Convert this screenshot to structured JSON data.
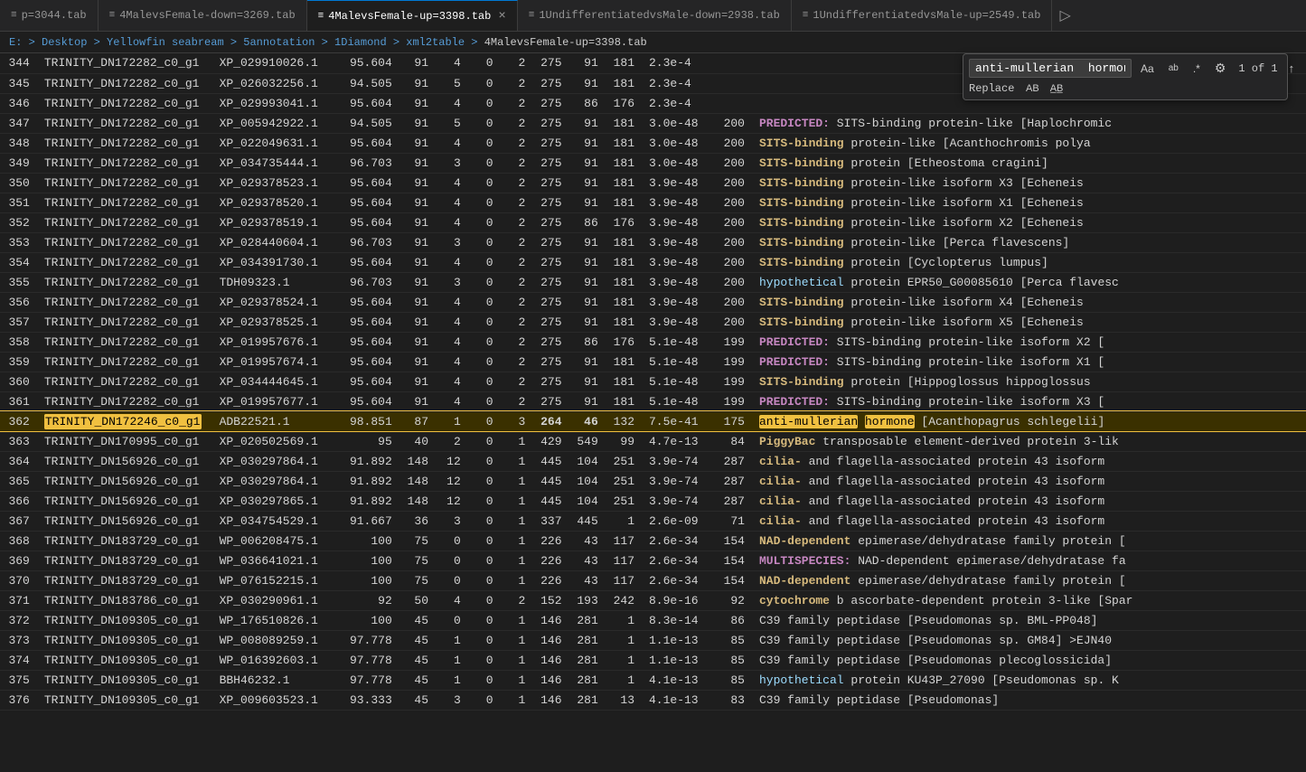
{
  "tabs": [
    {
      "id": "tab1",
      "icon": "≡",
      "label": "p=3044.tab",
      "active": false,
      "closable": false
    },
    {
      "id": "tab2",
      "icon": "≡",
      "label": "4MalevsFemale-down=3269.tab",
      "active": false,
      "closable": false
    },
    {
      "id": "tab3",
      "icon": "≡",
      "label": "4MalevsFemale-up=3398.tab",
      "active": true,
      "closable": true
    },
    {
      "id": "tab4",
      "icon": "≡",
      "label": "1UndifferentiatedvsMale-down=2938.tab",
      "active": false,
      "closable": false
    },
    {
      "id": "tab5",
      "icon": "≡",
      "label": "1UndifferentiatedvsMale-up=2549.tab",
      "active": false,
      "closable": false
    }
  ],
  "breadcrumb": {
    "parts": [
      "E:",
      "Desktop",
      "Yellowfin seabream",
      "5annotation",
      "1Diamond",
      "xml2table",
      "4MalevsFemale-up=3398.tab"
    ]
  },
  "find_widget": {
    "search_value": "anti-mullerian  hormone",
    "count_label": "1 of 1",
    "replace_label": "Replace",
    "buttons": {
      "match_case": "Aa",
      "whole_word": "ab",
      "regex": ".*",
      "settings": "⚙",
      "prev": "↑",
      "next": "↓",
      "expand": "☰",
      "close": "×",
      "replace_one": "AB",
      "replace_all": "AB̄"
    }
  },
  "table": {
    "rows": [
      {
        "line": 344,
        "trinity": "TRINITY_DN172282_c0_g1",
        "xp": "XP_029910026.1",
        "num1": "95.604",
        "num2": 91,
        "num3": 4,
        "num4": 0,
        "num5": 2,
        "num6": 275,
        "num7": 91,
        "num8": 181,
        "evalue": "2.3e-4",
        "score": "",
        "desc": "",
        "desc2": ""
      },
      {
        "line": 345,
        "trinity": "TRINITY_DN172282_c0_g1",
        "xp": "XP_026032256.1",
        "num1": "94.505",
        "num2": 91,
        "num3": 5,
        "num4": 0,
        "num5": 2,
        "num6": 275,
        "num7": 91,
        "num8": 181,
        "evalue": "2.3e-4",
        "score": "",
        "desc": "",
        "desc2": ""
      },
      {
        "line": 346,
        "trinity": "TRINITY_DN172282_c0_g1",
        "xp": "XP_029993041.1",
        "num1": "95.604",
        "num2": 91,
        "num3": 4,
        "num4": 0,
        "num5": 2,
        "num6": 275,
        "num7": 86,
        "num8": 176,
        "evalue": "2.3e-4",
        "score": "",
        "desc": "",
        "desc2": ""
      },
      {
        "line": 347,
        "trinity": "TRINITY_DN172282_c0_g1",
        "xp": "XP_005942922.1",
        "num1": "94.505",
        "num2": 91,
        "num3": 5,
        "num4": 0,
        "num5": 2,
        "num6": 275,
        "num7": 91,
        "num8": 181,
        "evalue": "3.0e-48",
        "score": 200,
        "desc": "PREDICTED:",
        "desc2": "SITS-binding protein-like [Haplochromic"
      },
      {
        "line": 348,
        "trinity": "TRINITY_DN172282_c0_g1",
        "xp": "XP_022049631.1",
        "num1": "95.604",
        "num2": 91,
        "num3": 4,
        "num4": 0,
        "num5": 2,
        "num6": 275,
        "num7": 91,
        "num8": 181,
        "evalue": "3.0e-48",
        "score": 200,
        "desc": "SITS-binding",
        "desc2": "protein-like [Acanthochromis polya"
      },
      {
        "line": 349,
        "trinity": "TRINITY_DN172282_c0_g1",
        "xp": "XP_034735444.1",
        "num1": "96.703",
        "num2": 91,
        "num3": 3,
        "num4": 0,
        "num5": 2,
        "num6": 275,
        "num7": 91,
        "num8": 181,
        "evalue": "3.0e-48",
        "score": 200,
        "desc": "SITS-binding",
        "desc2": "protein [Etheostoma cragini]"
      },
      {
        "line": 350,
        "trinity": "TRINITY_DN172282_c0_g1",
        "xp": "XP_029378523.1",
        "num1": "95.604",
        "num2": 91,
        "num3": 4,
        "num4": 0,
        "num5": 2,
        "num6": 275,
        "num7": 91,
        "num8": 181,
        "evalue": "3.9e-48",
        "score": 200,
        "desc": "SITS-binding",
        "desc2": "protein-like isoform X3 [Echeneis"
      },
      {
        "line": 351,
        "trinity": "TRINITY_DN172282_c0_g1",
        "xp": "XP_029378520.1",
        "num1": "95.604",
        "num2": 91,
        "num3": 4,
        "num4": 0,
        "num5": 2,
        "num6": 275,
        "num7": 91,
        "num8": 181,
        "evalue": "3.9e-48",
        "score": 200,
        "desc": "SITS-binding",
        "desc2": "protein-like isoform X1 [Echeneis"
      },
      {
        "line": 352,
        "trinity": "TRINITY_DN172282_c0_g1",
        "xp": "XP_029378519.1",
        "num1": "95.604",
        "num2": 91,
        "num3": 4,
        "num4": 0,
        "num5": 2,
        "num6": 275,
        "num7": 86,
        "num8": 176,
        "evalue": "3.9e-48",
        "score": 200,
        "desc": "SITS-binding",
        "desc2": "protein-like isoform X2 [Echeneis"
      },
      {
        "line": 353,
        "trinity": "TRINITY_DN172282_c0_g1",
        "xp": "XP_028440604.1",
        "num1": "96.703",
        "num2": 91,
        "num3": 3,
        "num4": 0,
        "num5": 2,
        "num6": 275,
        "num7": 91,
        "num8": 181,
        "evalue": "3.9e-48",
        "score": 200,
        "desc": "SITS-binding",
        "desc2": "protein-like [Perca flavescens]"
      },
      {
        "line": 354,
        "trinity": "TRINITY_DN172282_c0_g1",
        "xp": "XP_034391730.1",
        "num1": "95.604",
        "num2": 91,
        "num3": 4,
        "num4": 0,
        "num5": 2,
        "num6": 275,
        "num7": 91,
        "num8": 181,
        "evalue": "3.9e-48",
        "score": 200,
        "desc": "SITS-binding",
        "desc2": "protein [Cyclopterus lumpus]"
      },
      {
        "line": 355,
        "trinity": "TRINITY_DN172282_c0_g1",
        "xp": "TDH09323.1",
        "num1": "96.703",
        "num2": 91,
        "num3": 3,
        "num4": 0,
        "num5": 2,
        "num6": 275,
        "num7": 91,
        "num8": 181,
        "evalue": "3.9e-48",
        "score": 200,
        "desc": "hypothetical",
        "desc2": "protein EPR50_G00085610 [Perca flavesc"
      },
      {
        "line": 356,
        "trinity": "TRINITY_DN172282_c0_g1",
        "xp": "XP_029378524.1",
        "num1": "95.604",
        "num2": 91,
        "num3": 4,
        "num4": 0,
        "num5": 2,
        "num6": 275,
        "num7": 91,
        "num8": 181,
        "evalue": "3.9e-48",
        "score": 200,
        "desc": "SITS-binding",
        "desc2": "protein-like isoform X4 [Echeneis"
      },
      {
        "line": 357,
        "trinity": "TRINITY_DN172282_c0_g1",
        "xp": "XP_029378525.1",
        "num1": "95.604",
        "num2": 91,
        "num3": 4,
        "num4": 0,
        "num5": 2,
        "num6": 275,
        "num7": 91,
        "num8": 181,
        "evalue": "3.9e-48",
        "score": 200,
        "desc": "SITS-binding",
        "desc2": "protein-like isoform X5 [Echeneis"
      },
      {
        "line": 358,
        "trinity": "TRINITY_DN172282_c0_g1",
        "xp": "XP_019957676.1",
        "num1": "95.604",
        "num2": 91,
        "num3": 4,
        "num4": 0,
        "num5": 2,
        "num6": 275,
        "num7": 86,
        "num8": 176,
        "evalue": "5.1e-48",
        "score": 199,
        "desc": "PREDICTED:",
        "desc2": "SITS-binding protein-like isoform X2 ["
      },
      {
        "line": 359,
        "trinity": "TRINITY_DN172282_c0_g1",
        "xp": "XP_019957674.1",
        "num1": "95.604",
        "num2": 91,
        "num3": 4,
        "num4": 0,
        "num5": 2,
        "num6": 275,
        "num7": 91,
        "num8": 181,
        "evalue": "5.1e-48",
        "score": 199,
        "desc": "PREDICTED:",
        "desc2": "SITS-binding protein-like isoform X1 ["
      },
      {
        "line": 360,
        "trinity": "TRINITY_DN172282_c0_g1",
        "xp": "XP_034444645.1",
        "num1": "95.604",
        "num2": 91,
        "num3": 4,
        "num4": 0,
        "num5": 2,
        "num6": 275,
        "num7": 91,
        "num8": 181,
        "evalue": "5.1e-48",
        "score": 199,
        "desc": "SITS-binding",
        "desc2": "protein [Hippoglossus hippoglossus"
      },
      {
        "line": 361,
        "trinity": "TRINITY_DN172282_c0_g1",
        "xp": "XP_019957677.1",
        "num1": "95.604",
        "num2": 91,
        "num3": 4,
        "num4": 0,
        "num5": 2,
        "num6": 275,
        "num7": 91,
        "num8": 181,
        "evalue": "5.1e-48",
        "score": 199,
        "desc": "PREDICTED:",
        "desc2": "SITS-binding protein-like isoform X3 ["
      },
      {
        "line": 362,
        "trinity": "TRINITY_DN172246_c0_g1",
        "xp": "ADB22521.1",
        "num1": "98.851",
        "num2": 87,
        "num3": 1,
        "num4": 0,
        "num5": 3,
        "num6": 264,
        "num7": 46,
        "num8": 132,
        "evalue": "7.5e-41",
        "score": 175,
        "desc": "anti-mullerian",
        "desc2": "hormone [Acanthopagrus schlegelii]",
        "highlighted": true
      },
      {
        "line": 363,
        "trinity": "TRINITY_DN170995_c0_g1",
        "xp": "XP_020502569.1",
        "num1": "95",
        "num2": 40,
        "num3": 2,
        "num4": 0,
        "num5": 1,
        "num6": 429,
        "num7": 549,
        "num8": 99,
        "evalue": "4.7e-13",
        "score": 84,
        "desc": "PiggyBac",
        "desc2": "transposable element-derived protein 3-lik"
      },
      {
        "line": 364,
        "trinity": "TRINITY_DN156926_c0_g1",
        "xp": "XP_030297864.1",
        "num1": "91.892",
        "num2": 148,
        "num3": 12,
        "num4": 0,
        "num5": 1,
        "num6": 445,
        "num7": 104,
        "num8": 251,
        "evalue": "3.9e-74",
        "score": 287,
        "desc": "cilia-",
        "desc2": "and flagella-associated protein 43 isoform"
      },
      {
        "line": 365,
        "trinity": "TRINITY_DN156926_c0_g1",
        "xp": "XP_030297864.1",
        "num1": "91.892",
        "num2": 148,
        "num3": 12,
        "num4": 0,
        "num5": 1,
        "num6": 445,
        "num7": 104,
        "num8": 251,
        "evalue": "3.9e-74",
        "score": 287,
        "desc": "cilia-",
        "desc2": "and flagella-associated protein 43 isoform"
      },
      {
        "line": 366,
        "trinity": "TRINITY_DN156926_c0_g1",
        "xp": "XP_030297865.1",
        "num1": "91.892",
        "num2": 148,
        "num3": 12,
        "num4": 0,
        "num5": 1,
        "num6": 445,
        "num7": 104,
        "num8": 251,
        "evalue": "3.9e-74",
        "score": 287,
        "desc": "cilia-",
        "desc2": "and flagella-associated protein 43 isoform"
      },
      {
        "line": 367,
        "trinity": "TRINITY_DN156926_c0_g1",
        "xp": "XP_034754529.1",
        "num1": "91.667",
        "num2": 36,
        "num3": 3,
        "num4": 0,
        "num5": 1,
        "num6": 337,
        "num7": 445,
        "num8": 1,
        "evalue": "2.6e-09",
        "score": 71,
        "desc": "cilia-",
        "desc2": "and flagella-associated protein 43 isoform"
      },
      {
        "line": 368,
        "trinity": "TRINITY_DN183729_c0_g1",
        "xp": "WP_006208475.1",
        "num1": "100",
        "num2": 75,
        "num3": 0,
        "num4": 0,
        "num5": 1,
        "num6": 226,
        "num7": 43,
        "num8": 117,
        "evalue": "2.6e-34",
        "score": 154,
        "desc": "NAD-dependent",
        "desc2": "epimerase/dehydratase family protein ["
      },
      {
        "line": 369,
        "trinity": "TRINITY_DN183729_c0_g1",
        "xp": "WP_036641021.1",
        "num1": "100",
        "num2": 75,
        "num3": 0,
        "num4": 0,
        "num5": 1,
        "num6": 226,
        "num7": 43,
        "num8": 117,
        "evalue": "2.6e-34",
        "score": 154,
        "desc": "MULTISPECIES:",
        "desc2": "NAD-dependent epimerase/dehydratase fa"
      },
      {
        "line": 370,
        "trinity": "TRINITY_DN183729_c0_g1",
        "xp": "WP_076152215.1",
        "num1": "100",
        "num2": 75,
        "num3": 0,
        "num4": 0,
        "num5": 1,
        "num6": 226,
        "num7": 43,
        "num8": 117,
        "evalue": "2.6e-34",
        "score": 154,
        "desc": "NAD-dependent",
        "desc2": "epimerase/dehydratase family protein ["
      },
      {
        "line": 371,
        "trinity": "TRINITY_DN183786_c0_g1",
        "xp": "XP_030290961.1",
        "num1": "92",
        "num2": 50,
        "num3": 4,
        "num4": 0,
        "num5": 2,
        "num6": 152,
        "num7": 193,
        "num8": 242,
        "evalue": "8.9e-16",
        "score": 92,
        "desc": "cytochrome",
        "desc2": "b ascorbate-dependent protein 3-like [Spar"
      },
      {
        "line": 372,
        "trinity": "TRINITY_DN109305_c0_g1",
        "xp": "WP_176510826.1",
        "num1": "100",
        "num2": 45,
        "num3": 0,
        "num4": 0,
        "num5": 1,
        "num6": 146,
        "num7": 281,
        "num8": 1,
        "evalue": "8.3e-14",
        "score": 86,
        "desc": "C39 family peptidase [Pseudomonas sp. BML-PP048]",
        "desc2": ""
      },
      {
        "line": 373,
        "trinity": "TRINITY_DN109305_c0_g1",
        "xp": "WP_008089259.1",
        "num1": "97.778",
        "num2": 45,
        "num3": 1,
        "num4": 0,
        "num5": 1,
        "num6": 146,
        "num7": 281,
        "num8": 1,
        "evalue": "1.1e-13",
        "score": 85,
        "desc": "C39 family peptidase [Pseudomonas sp. GM84] >EJN40",
        "desc2": ""
      },
      {
        "line": 374,
        "trinity": "TRINITY_DN109305_c0_g1",
        "xp": "WP_016392603.1",
        "num1": "97.778",
        "num2": 45,
        "num3": 1,
        "num4": 0,
        "num5": 1,
        "num6": 146,
        "num7": 281,
        "num8": 1,
        "evalue": "1.1e-13",
        "score": 85,
        "desc": "C39 family peptidase [Pseudomonas plecoglossicida]",
        "desc2": ""
      },
      {
        "line": 375,
        "trinity": "TRINITY_DN109305_c0_g1",
        "xp": "BBH46232.1",
        "num1": "97.778",
        "num2": 45,
        "num3": 1,
        "num4": 0,
        "num5": 1,
        "num6": 146,
        "num7": 281,
        "num8": 1,
        "evalue": "4.1e-13",
        "score": 85,
        "desc": "hypothetical",
        "desc2": "protein KU43P_27090 [Pseudomonas sp. K"
      },
      {
        "line": 376,
        "trinity": "TRINITY_DN109305_c0_g1",
        "xp": "XP_009603523.1",
        "num1": "93.333",
        "num2": 45,
        "num3": 3,
        "num4": 0,
        "num5": 1,
        "num6": 146,
        "num7": 281,
        "num8": 13,
        "evalue": "4.1e-13",
        "score": 83,
        "desc": "C39 family peptidase [Pseudomonas]",
        "desc2": ""
      }
    ]
  },
  "colors": {
    "accent": "#0078d4",
    "highlight_row_bg": "#3a3000",
    "highlight_row_border": "#f0c040",
    "match_bg": "#f0c040",
    "match_text": "#000000"
  }
}
